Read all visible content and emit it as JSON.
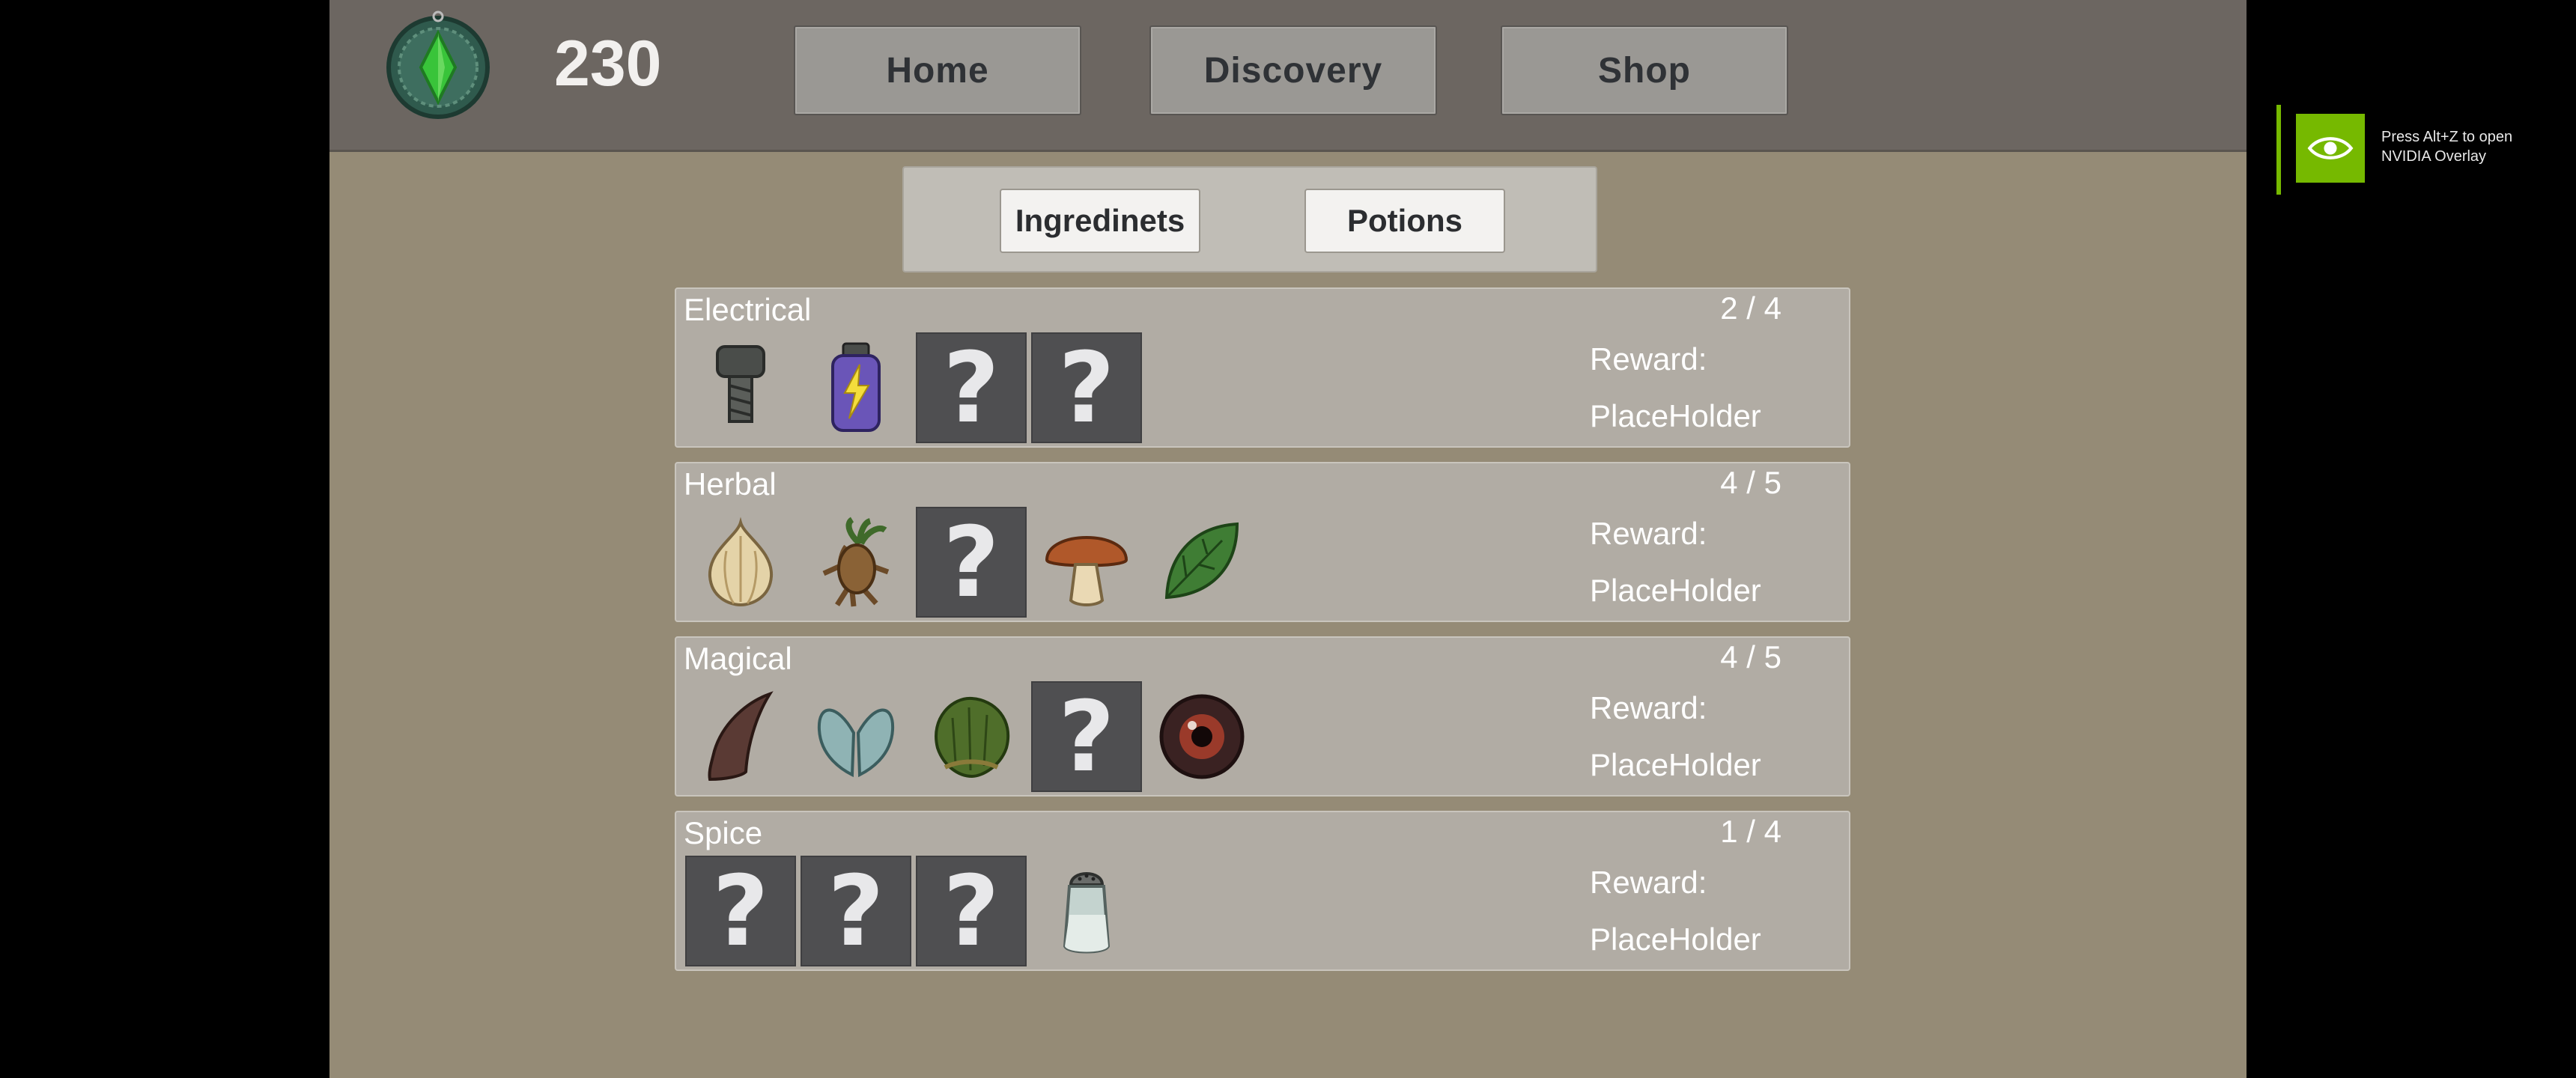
{
  "currency": {
    "amount": "230"
  },
  "nav": {
    "home": "Home",
    "discovery": "Discovery",
    "shop": "Shop"
  },
  "tabs": {
    "ingredients": "Ingredinets",
    "potions": "Potions"
  },
  "categories": [
    {
      "name": "Electrical",
      "count": "2 / 4",
      "reward_label": "Reward:",
      "reward_value": "PlaceHolder",
      "slots": [
        "bolt-icon",
        "lightning-jar-icon",
        "unknown",
        "unknown"
      ]
    },
    {
      "name": "Herbal",
      "count": "4 / 5",
      "reward_label": "Reward:",
      "reward_value": "PlaceHolder",
      "slots": [
        "garlic-icon",
        "mandrake-root-icon",
        "unknown",
        "mushroom-icon",
        "leaf-icon"
      ]
    },
    {
      "name": "Magical",
      "count": "4 / 5",
      "reward_label": "Reward:",
      "reward_value": "PlaceHolder",
      "slots": [
        "horn-icon",
        "fairy-wings-icon",
        "moss-icon",
        "unknown",
        "eyeball-icon"
      ]
    },
    {
      "name": "Spice",
      "count": "1 / 4",
      "reward_label": "Reward:",
      "reward_value": "PlaceHolder",
      "slots": [
        "unknown",
        "unknown",
        "unknown",
        "salt-shaker-icon"
      ]
    }
  ],
  "unknown_glyph": "?",
  "overlay": {
    "text": "Press Alt+Z to open NVIDIA Overlay"
  },
  "colors": {
    "background": "#958b76",
    "topbar": "#6c6661",
    "panel": "#b1aca4",
    "unknown_slot": "#4f4f51",
    "nvidia_green": "#76b900"
  }
}
